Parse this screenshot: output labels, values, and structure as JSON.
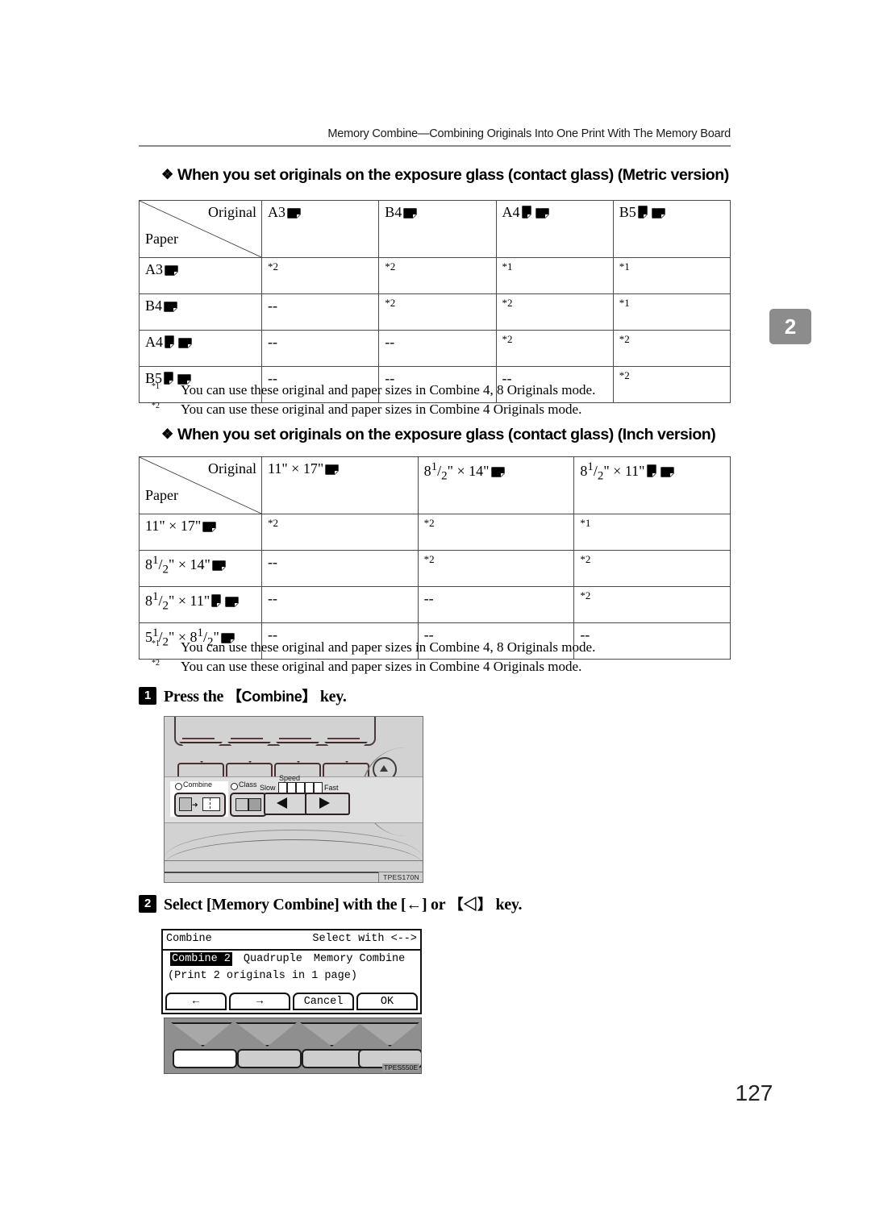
{
  "running_head": "Memory Combine—Combining Originals Into One Print With The Memory Board",
  "chapter_tab": "2",
  "page_number": "127",
  "sections": [
    {
      "heading": "When you set originals on the exposure glass (contact glass) (Metric version)",
      "table": {
        "corner_original": "Original",
        "corner_paper": "Paper",
        "columns": [
          {
            "label": "A3",
            "orientations": [
              "landscape"
            ]
          },
          {
            "label": "B4",
            "orientations": [
              "landscape"
            ]
          },
          {
            "label": "A4",
            "orientations": [
              "portrait",
              "landscape"
            ]
          },
          {
            "label": "B5",
            "orientations": [
              "portrait",
              "landscape"
            ]
          }
        ],
        "rows": [
          {
            "label": "A3",
            "orientations": [
              "landscape"
            ],
            "cells": [
              "*2",
              "*2",
              "*1",
              "*1"
            ]
          },
          {
            "label": "B4",
            "orientations": [
              "landscape"
            ],
            "cells": [
              "--",
              "*2",
              "*2",
              "*1"
            ]
          },
          {
            "label": "A4",
            "orientations": [
              "portrait",
              "landscape"
            ],
            "cells": [
              "--",
              "--",
              "*2",
              "*2"
            ]
          },
          {
            "label": "B5",
            "orientations": [
              "portrait",
              "landscape"
            ],
            "cells": [
              "--",
              "--",
              "--",
              "*2"
            ]
          }
        ]
      },
      "footnotes": [
        {
          "mark": "*1",
          "text": "You can use these original and paper sizes in Combine 4, 8 Originals mode."
        },
        {
          "mark": "*2",
          "text": "You can use these original and paper sizes in Combine 4 Originals mode."
        }
      ]
    },
    {
      "heading": "When you set originals on the exposure glass (contact glass) (Inch version)",
      "table": {
        "corner_original": "Original",
        "corner_paper": "Paper",
        "columns": [
          {
            "label": "11\" × 17\"",
            "orientations": [
              "landscape"
            ]
          },
          {
            "label": "8<sup>1</sup>/<sub>2</sub>\" × 14\"",
            "orientations": [
              "landscape"
            ]
          },
          {
            "label": "8<sup>1</sup>/<sub>2</sub>\" × 11\"",
            "orientations": [
              "portrait",
              "landscape"
            ]
          }
        ],
        "rows": [
          {
            "label": "11\" × 17\"",
            "orientations": [
              "landscape"
            ],
            "cells": [
              "*2",
              "*2",
              "*1"
            ]
          },
          {
            "label": "8<sup>1</sup>/<sub>2</sub>\" × 14\"",
            "orientations": [
              "landscape"
            ],
            "cells": [
              "--",
              "*2",
              "*2"
            ]
          },
          {
            "label": "8<sup>1</sup>/<sub>2</sub>\" × 11\"",
            "orientations": [
              "portrait",
              "landscape"
            ],
            "cells": [
              "--",
              "--",
              "*2"
            ]
          },
          {
            "label": "5<sup>1</sup>/<sub>2</sub>\" × 8<sup>1</sup>/<sub>2</sub>\"",
            "orientations": [
              "landscape"
            ],
            "cells": [
              "--",
              "--",
              "--"
            ]
          }
        ]
      },
      "footnotes": [
        {
          "mark": "*1",
          "text": "You can use these original and paper sizes in Combine 4, 8 Originals mode."
        },
        {
          "mark": "*2",
          "text": "You can use these original and paper sizes in Combine 4 Originals mode."
        }
      ]
    }
  ],
  "steps": [
    {
      "num": "1",
      "text_before": "Press the ",
      "keycap": "【Combine】",
      "text_after": " key."
    },
    {
      "num": "2",
      "text_before": "Select [Memory Combine] with the [←] or ",
      "keycap": "【◁】",
      "text_after": " key."
    }
  ],
  "figure_control_panel": {
    "code": "TPES170N",
    "combine_label": "Combine",
    "class_label": "Class",
    "speed_label": "Speed",
    "slow_label": "Slow",
    "fast_label": "Fast"
  },
  "figure_lcd": {
    "title": "Combine",
    "hint": "Select with <-->",
    "selected_option": "Combine 2",
    "option_2": "Quadruple",
    "option_3": "Memory Combine",
    "description": "(Print 2 originals in 1 page)",
    "buttons": [
      "←",
      "→",
      "Cancel",
      "OK"
    ]
  },
  "figure_keystrip": {
    "code": "TPES550E"
  }
}
